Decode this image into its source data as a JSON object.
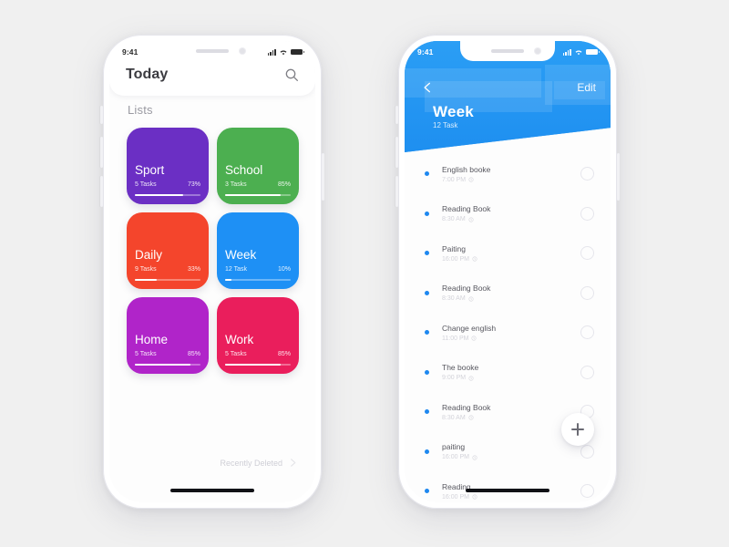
{
  "left_phone": {
    "status_bar": {
      "time": "9:41",
      "signal_icon": "signal-bars-icon",
      "wifi_icon": "wifi-icon",
      "battery_icon": "battery-icon"
    },
    "header": {
      "title": "Today",
      "search_icon": "search-icon"
    },
    "section_label": "Lists",
    "cards": [
      {
        "name": "Sport",
        "tasks": "5 Tasks",
        "percent": "73%",
        "progress": 73,
        "color": "#6b2fc4"
      },
      {
        "name": "School",
        "tasks": "3 Tasks",
        "percent": "85%",
        "progress": 85,
        "color": "#4caf50"
      },
      {
        "name": "Daily",
        "tasks": "9 Tasks",
        "percent": "33%",
        "progress": 33,
        "color": "#f4452c"
      },
      {
        "name": "Week",
        "tasks": "12 Task",
        "percent": "10%",
        "progress": 10,
        "color": "#1e90f5"
      },
      {
        "name": "Home",
        "tasks": "5 Tasks",
        "percent": "85%",
        "progress": 85,
        "color": "#b024c9"
      },
      {
        "name": "Work",
        "tasks": "5 Tasks",
        "percent": "85%",
        "progress": 85,
        "color": "#ea1e5c"
      }
    ],
    "recently_deleted": {
      "label": "Recently Deleted",
      "chevron_icon": "chevron-right-icon"
    }
  },
  "right_phone": {
    "status_bar": {
      "time": "9:41",
      "signal_icon": "signal-bars-icon",
      "wifi_icon": "wifi-icon",
      "battery_icon": "battery-icon"
    },
    "header": {
      "back_icon": "chevron-left-icon",
      "edit_label": "Edit",
      "title": "Week",
      "subtitle": "12 Task",
      "color": "#2196f3"
    },
    "tasks": [
      {
        "title": "English booke",
        "time": "7:00 PM"
      },
      {
        "title": "Reading Book",
        "time": "8:30 AM"
      },
      {
        "title": "Paiting",
        "time": "16:00 PM"
      },
      {
        "title": "Reading Book",
        "time": "8:30 AM"
      },
      {
        "title": "Change english",
        "time": "11:00 PM"
      },
      {
        "title": "The booke",
        "time": "9:00 PM"
      },
      {
        "title": "Reading Book",
        "time": "8:30 AM"
      },
      {
        "title": "paiting",
        "time": "16:00 PM"
      },
      {
        "title": "Reading",
        "time": "16:00 PM"
      }
    ],
    "fab": {
      "icon": "plus-icon",
      "label": "+"
    }
  }
}
